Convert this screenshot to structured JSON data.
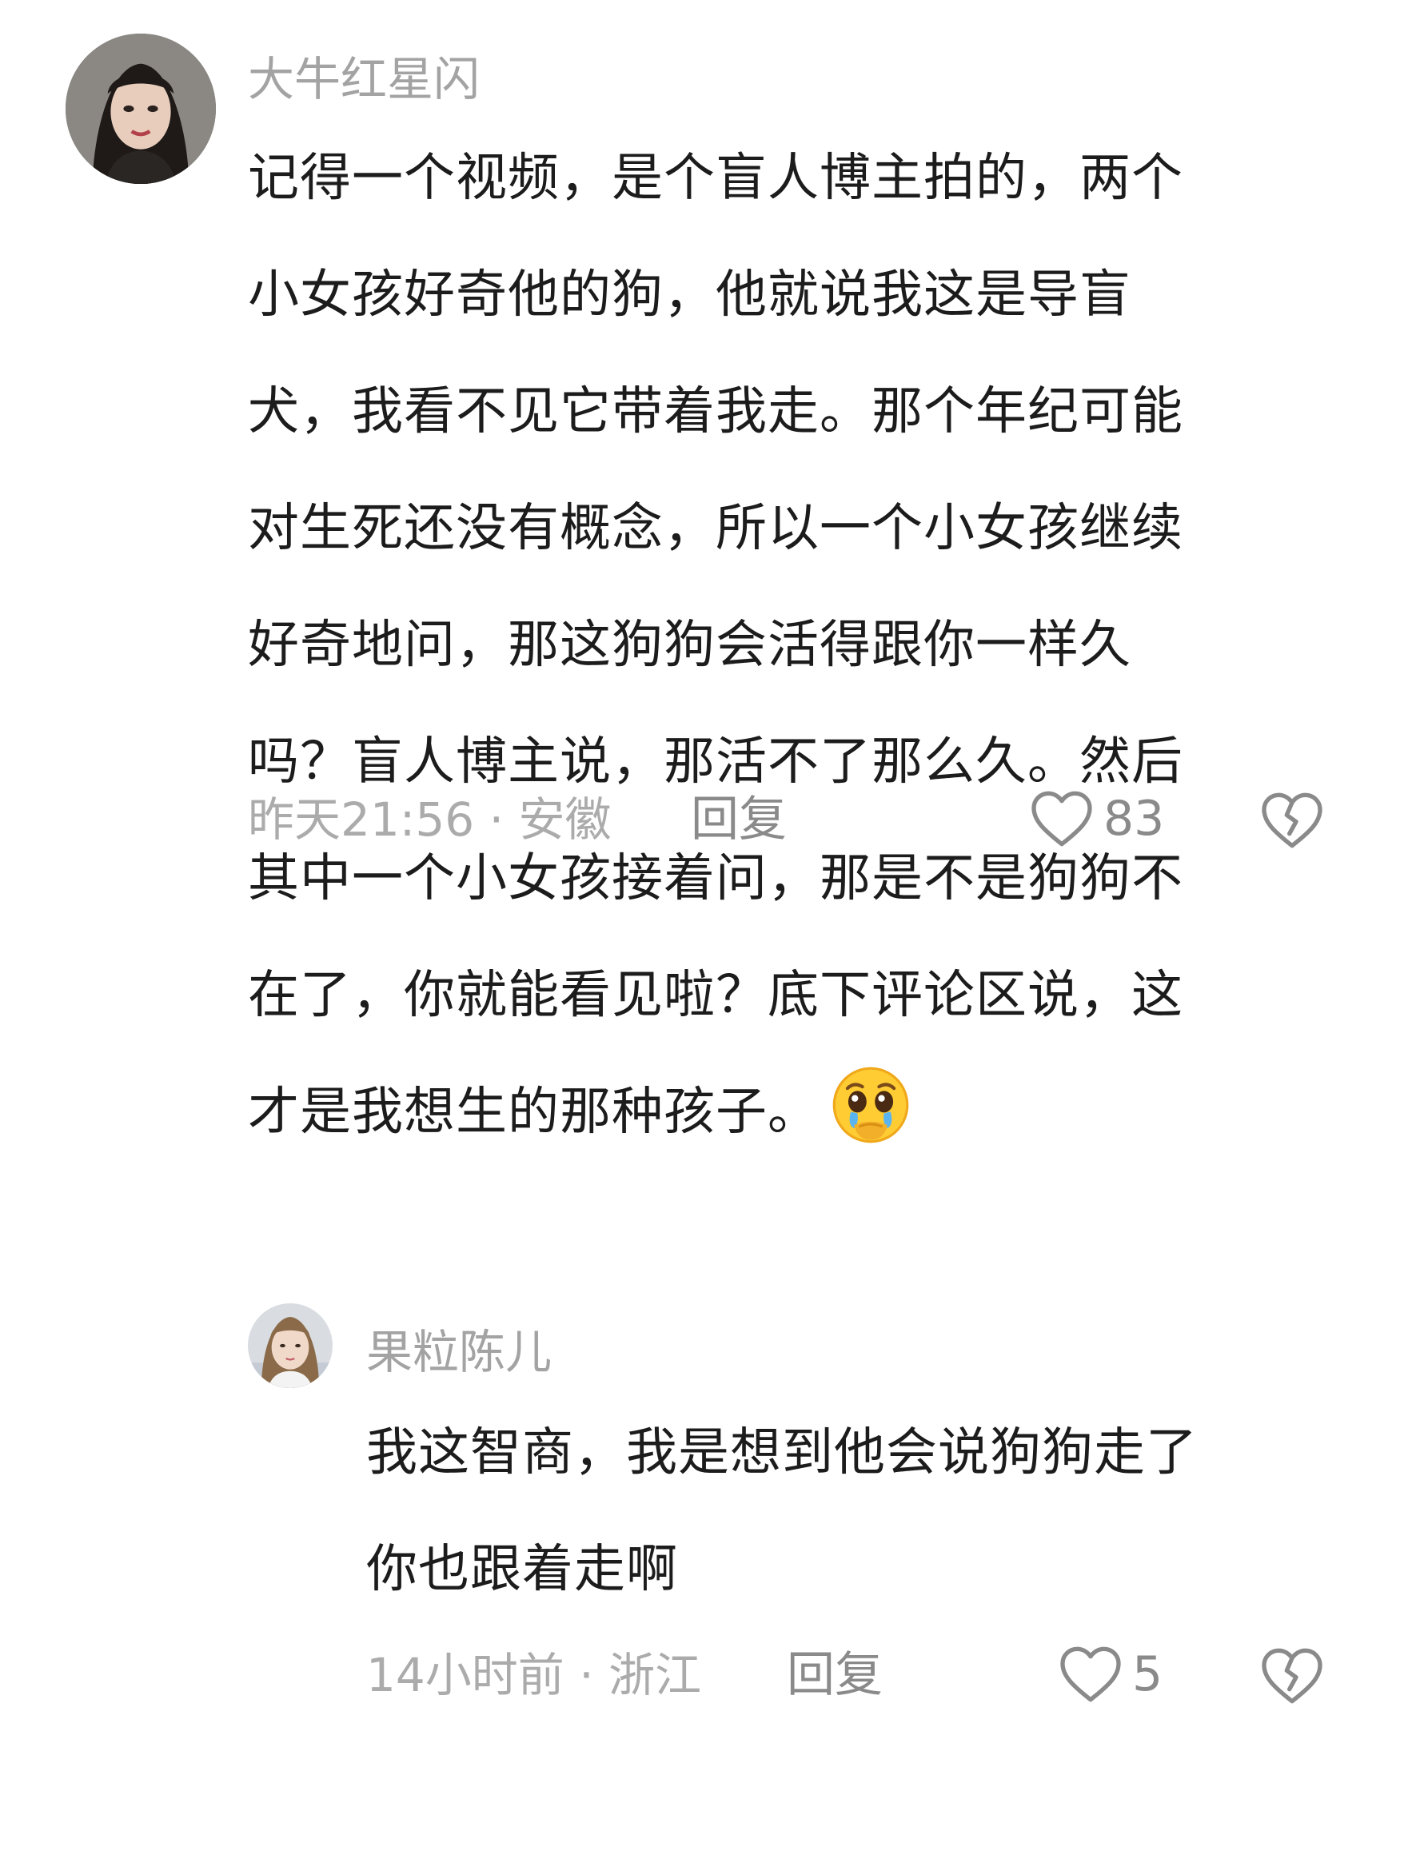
{
  "comment": {
    "username": "大牛红星闪",
    "avatar_icon": "user-avatar-photo",
    "lines": [
      "记得一个视频，是个盲人博主拍的，两个",
      "小女孩好奇他的狗，他就说我这是导盲",
      "犬，我看不见它带着我走。那个年纪可能",
      "对生死还没有概念，所以一个小女孩继续",
      "好奇地问，那这狗狗会活得跟你一样久",
      "吗？盲人博主说，那活不了那么久。然后",
      "其中一个小女孩接着问，那是不是狗狗不",
      "在了，你就能看见啦？底下评论区说，这",
      "才是我想生的那种孩子。"
    ],
    "emoji_icon": "pleading-crying-face-emoji",
    "meta": "昨天21:56 · 安徽",
    "reply_label": "回复",
    "like_count": "83",
    "like_icon": "heart-icon",
    "dislike_icon": "broken-heart-icon"
  },
  "reply": {
    "username": "果粒陈儿",
    "avatar_icon": "user-avatar-photo",
    "lines": [
      "我这智商，我是想到他会说狗狗走了",
      "你也跟着走啊"
    ],
    "meta": "14小时前 · 浙江",
    "reply_label": "回复",
    "like_count": "5",
    "like_icon": "heart-icon",
    "dislike_icon": "broken-heart-icon"
  },
  "colors": {
    "background": "#ffffff",
    "text": "#1c1c1c",
    "username": "#a3a3a3",
    "meta": "#ababab",
    "action": "#8a8a8a"
  }
}
